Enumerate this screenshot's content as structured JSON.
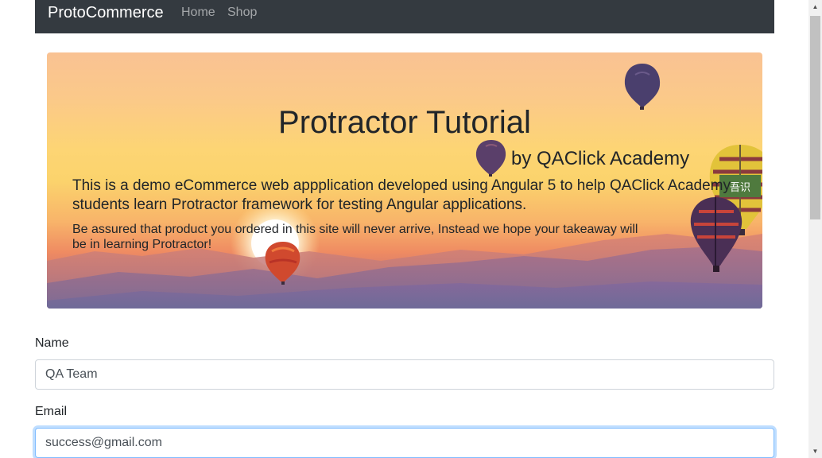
{
  "navbar": {
    "brand": "ProtoCommerce",
    "links": [
      {
        "label": "Home"
      },
      {
        "label": "Shop"
      }
    ]
  },
  "banner": {
    "title": "Protractor Tutorial",
    "subtitle": "by QAClick Academy",
    "lead": "This is a demo eCommerce web appplication developed using Angular 5 to help QAClick Academy students learn Protractor framework for testing Angular applications.",
    "note": "Be assured that product you ordered in this site will never arrive, Instead we hope your takeaway will be in learning Protractor!",
    "balloon_text": "吾识"
  },
  "form": {
    "name": {
      "label": "Name",
      "value": "QA Team"
    },
    "email": {
      "label": "Email",
      "value": "success@gmail.com"
    }
  },
  "scrollbar": {
    "up_icon": "▲",
    "down_icon": "▼"
  },
  "colors": {
    "navbar_bg": "#343a40",
    "focus_border": "#80bdff"
  }
}
